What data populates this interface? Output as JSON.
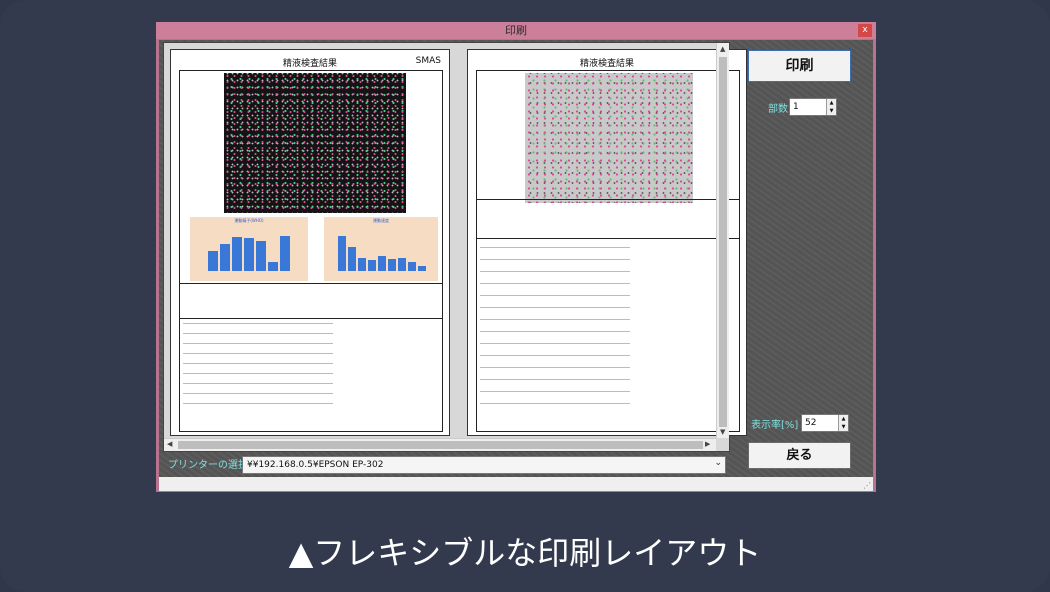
{
  "window": {
    "title": "印刷",
    "close_label": "x"
  },
  "preview": {
    "page1_title": "精液検査結果",
    "page1_tag": "SMAS",
    "page2_title": "精液検査結果",
    "chart1_title": "運動精子(WHO)",
    "chart1_values": [
      0.45,
      0.62,
      0.78,
      0.74,
      0.68,
      0.2,
      0.8
    ],
    "chart2_title": "運動速度",
    "chart2_values": [
      0.8,
      0.55,
      0.3,
      0.25,
      0.35,
      0.28,
      0.3,
      0.2,
      0.12
    ]
  },
  "controls": {
    "print_label": "印刷",
    "copies_label": "部数",
    "copies_value": "1",
    "zoom_label": "表示率[%]",
    "zoom_value": "52",
    "back_label": "戻る",
    "printer_label": "プリンターの選択",
    "printer_value": "¥¥192.168.0.5¥EPSON EP-302"
  },
  "caption": "▲フレキシブルな印刷レイアウト",
  "colors": {
    "background": "#333a4d",
    "titlebar": "#cc7f98",
    "label": "#7ee0e0"
  }
}
